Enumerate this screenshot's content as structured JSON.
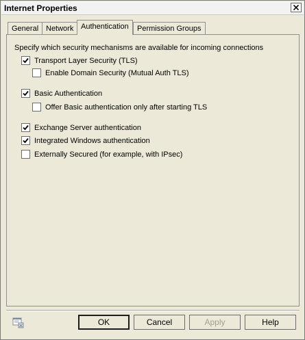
{
  "window": {
    "title": "Internet Properties"
  },
  "tabs": [
    {
      "label": "General"
    },
    {
      "label": "Network"
    },
    {
      "label": "Authentication"
    },
    {
      "label": "Permission Groups"
    }
  ],
  "auth": {
    "description": "Specify which security mechanisms are available for incoming connections",
    "options": [
      {
        "label": "Transport Layer Security (TLS)",
        "checked": true
      },
      {
        "label": "Enable Domain Security (Mutual Auth TLS)",
        "checked": false
      },
      {
        "label": "Basic Authentication",
        "checked": true
      },
      {
        "label": "Offer Basic authentication only after starting TLS",
        "checked": false
      },
      {
        "label": "Exchange Server authentication",
        "checked": true
      },
      {
        "label": "Integrated Windows authentication",
        "checked": true
      },
      {
        "label": "Externally Secured (for example, with IPsec)",
        "checked": false
      }
    ]
  },
  "buttons": {
    "ok": "OK",
    "cancel": "Cancel",
    "apply": "Apply",
    "help": "Help"
  },
  "icons": {
    "close": "close-icon",
    "check": "checkmark-icon",
    "properties": "properties-icon"
  }
}
